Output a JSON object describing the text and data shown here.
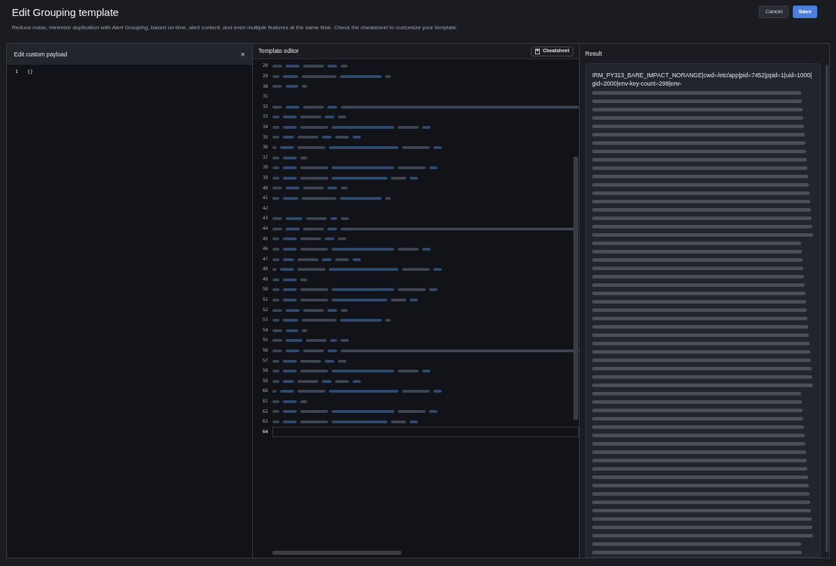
{
  "header": {
    "title": "Edit Grouping template",
    "description": "Reduce noise, minimize duplication with Alert Grouping, based on time, alert content, and even multiple features at the same time. Check the cheatsheet to customize your template.",
    "buttons": [
      {
        "label": "Cancel",
        "kind": "secondary"
      },
      {
        "label": "Save",
        "kind": "primary"
      }
    ]
  },
  "payload_panel": {
    "title": "Edit custom payload",
    "close": "×",
    "lines": [
      {
        "number": "1",
        "text": "{}"
      }
    ]
  },
  "template_panel": {
    "title": "Template editor",
    "cheatsheet_button": "Cheatsheet",
    "lines": [
      {
        "number": "28",
        "kind": "blurred"
      },
      {
        "number": "29",
        "kind": "blurred"
      },
      {
        "number": "30",
        "kind": "blurred"
      },
      {
        "number": "31",
        "kind": "empty"
      },
      {
        "number": "32",
        "kind": "blurred"
      },
      {
        "number": "33",
        "kind": "blurred"
      },
      {
        "number": "34",
        "kind": "blurred"
      },
      {
        "number": "35",
        "kind": "blurred"
      },
      {
        "number": "36",
        "kind": "blurred"
      },
      {
        "number": "37",
        "kind": "blurred"
      },
      {
        "number": "38",
        "kind": "blurred"
      },
      {
        "number": "39",
        "kind": "blurred"
      },
      {
        "number": "40",
        "kind": "blurred"
      },
      {
        "number": "41",
        "kind": "blurred"
      },
      {
        "number": "42",
        "kind": "empty"
      },
      {
        "number": "43",
        "kind": "blurred"
      },
      {
        "number": "44",
        "kind": "blurred"
      },
      {
        "number": "45",
        "kind": "blurred"
      },
      {
        "number": "46",
        "kind": "blurred"
      },
      {
        "number": "47",
        "kind": "blurred"
      },
      {
        "number": "48",
        "kind": "blurred"
      },
      {
        "number": "49",
        "kind": "blurred"
      },
      {
        "number": "50",
        "kind": "blurred"
      },
      {
        "number": "51",
        "kind": "blurred"
      },
      {
        "number": "52",
        "kind": "blurred"
      },
      {
        "number": "53",
        "kind": "blurred"
      },
      {
        "number": "54",
        "kind": "blurred"
      },
      {
        "number": "55",
        "kind": "blurred"
      },
      {
        "number": "56",
        "kind": "blurred"
      },
      {
        "number": "57",
        "kind": "blurred"
      },
      {
        "number": "58",
        "kind": "blurred"
      },
      {
        "number": "59",
        "kind": "blurred"
      },
      {
        "number": "60",
        "kind": "blurred"
      },
      {
        "number": "61",
        "kind": "blurred"
      },
      {
        "number": "62",
        "kind": "blurred"
      },
      {
        "number": "63",
        "kind": "blurred"
      },
      {
        "number": "64",
        "kind": "empty",
        "selected": true
      }
    ]
  },
  "result_panel": {
    "title": "Result",
    "text": "IRM_PY313_BARE_IMPACT_NORANGE|cwd=/etc/app|pid=7452|ppid=1|uid=1000|gid=2000|env-key-count=299|env-"
  }
}
